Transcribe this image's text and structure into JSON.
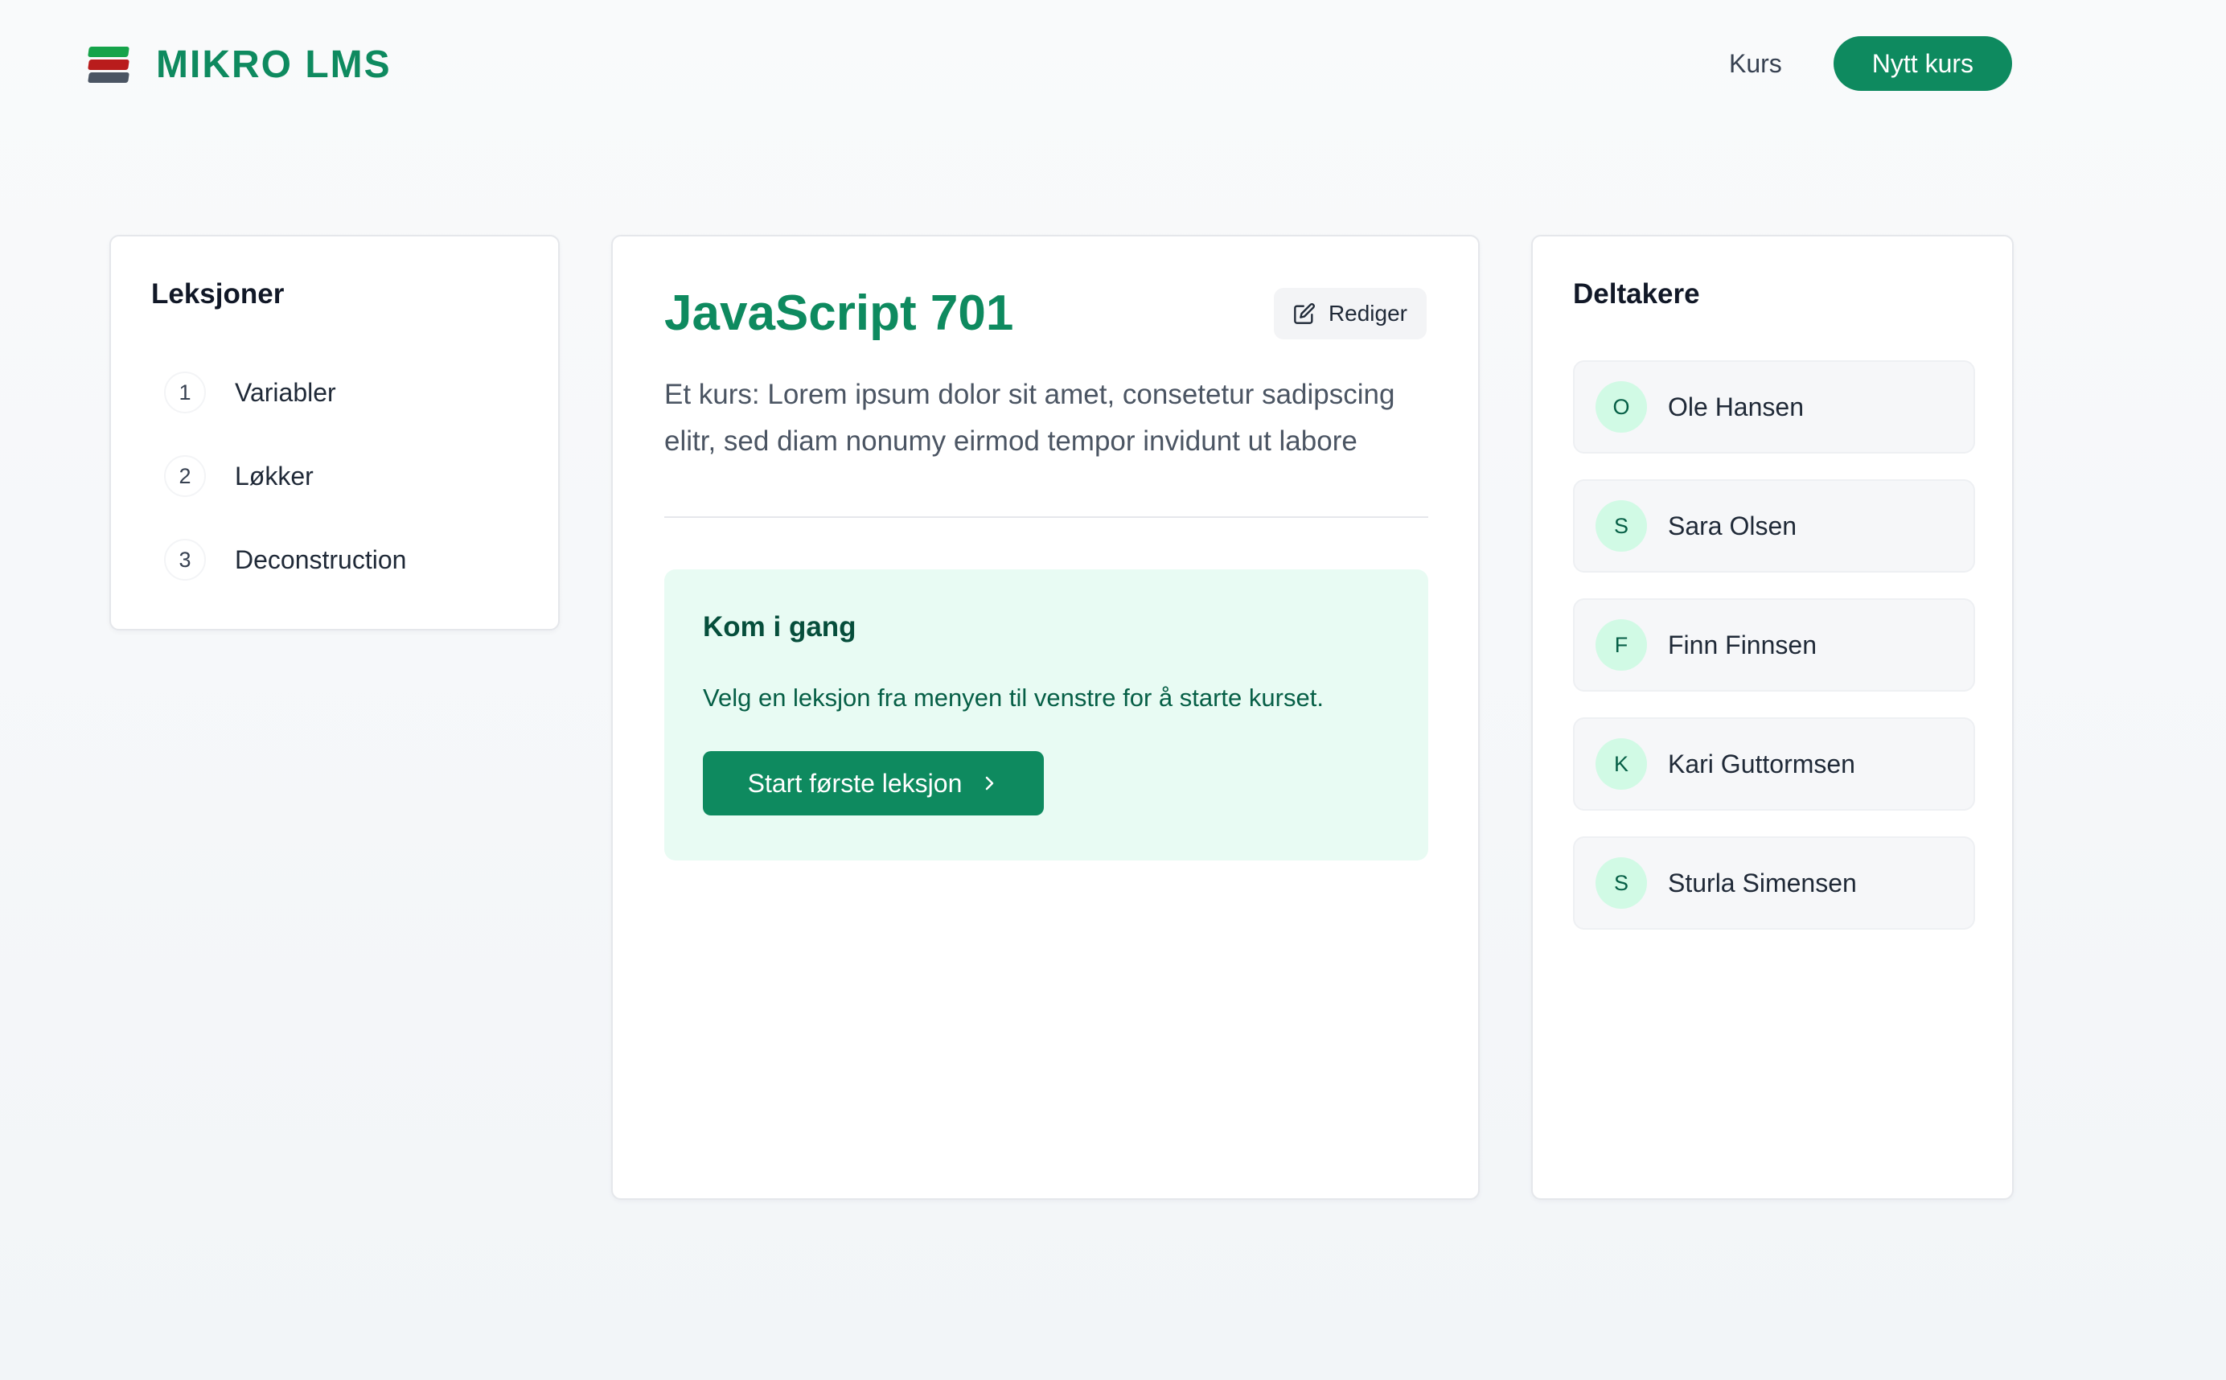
{
  "app": {
    "logo_icon": "books-icon",
    "name": "MIKRO LMS"
  },
  "nav": {
    "courses_label": "Kurs",
    "new_course_label": "Nytt kurs"
  },
  "lessons": {
    "title": "Leksjoner",
    "items": [
      {
        "num": "1",
        "label": "Variabler"
      },
      {
        "num": "2",
        "label": "Løkker"
      },
      {
        "num": "3",
        "label": "Deconstruction"
      }
    ]
  },
  "course": {
    "title": "JavaScript 701",
    "edit_label": "Rediger",
    "edit_icon": "edit-icon",
    "description": "Et kurs: Lorem ipsum dolor sit amet, consetetur sadipscing elitr, sed diam nonumy eirmod tempor invidunt ut labore",
    "get_started": {
      "title": "Kom i gang",
      "text": "Velg en leksjon fra menyen til venstre for å starte kurset.",
      "button_label": "Start første leksjon",
      "button_icon": "chevron-right-icon"
    }
  },
  "participants": {
    "title": "Deltakere",
    "items": [
      {
        "initial": "O",
        "name": "Ole Hansen"
      },
      {
        "initial": "S",
        "name": "Sara Olsen"
      },
      {
        "initial": "F",
        "name": "Finn Finnsen"
      },
      {
        "initial": "K",
        "name": "Kari Guttormsen"
      },
      {
        "initial": "S",
        "name": "Sturla Simensen"
      }
    ]
  },
  "colors": {
    "brand": "#0e8a5f",
    "start_box_bg": "#e8fbf3",
    "avatar_bg": "#d1fae5"
  }
}
